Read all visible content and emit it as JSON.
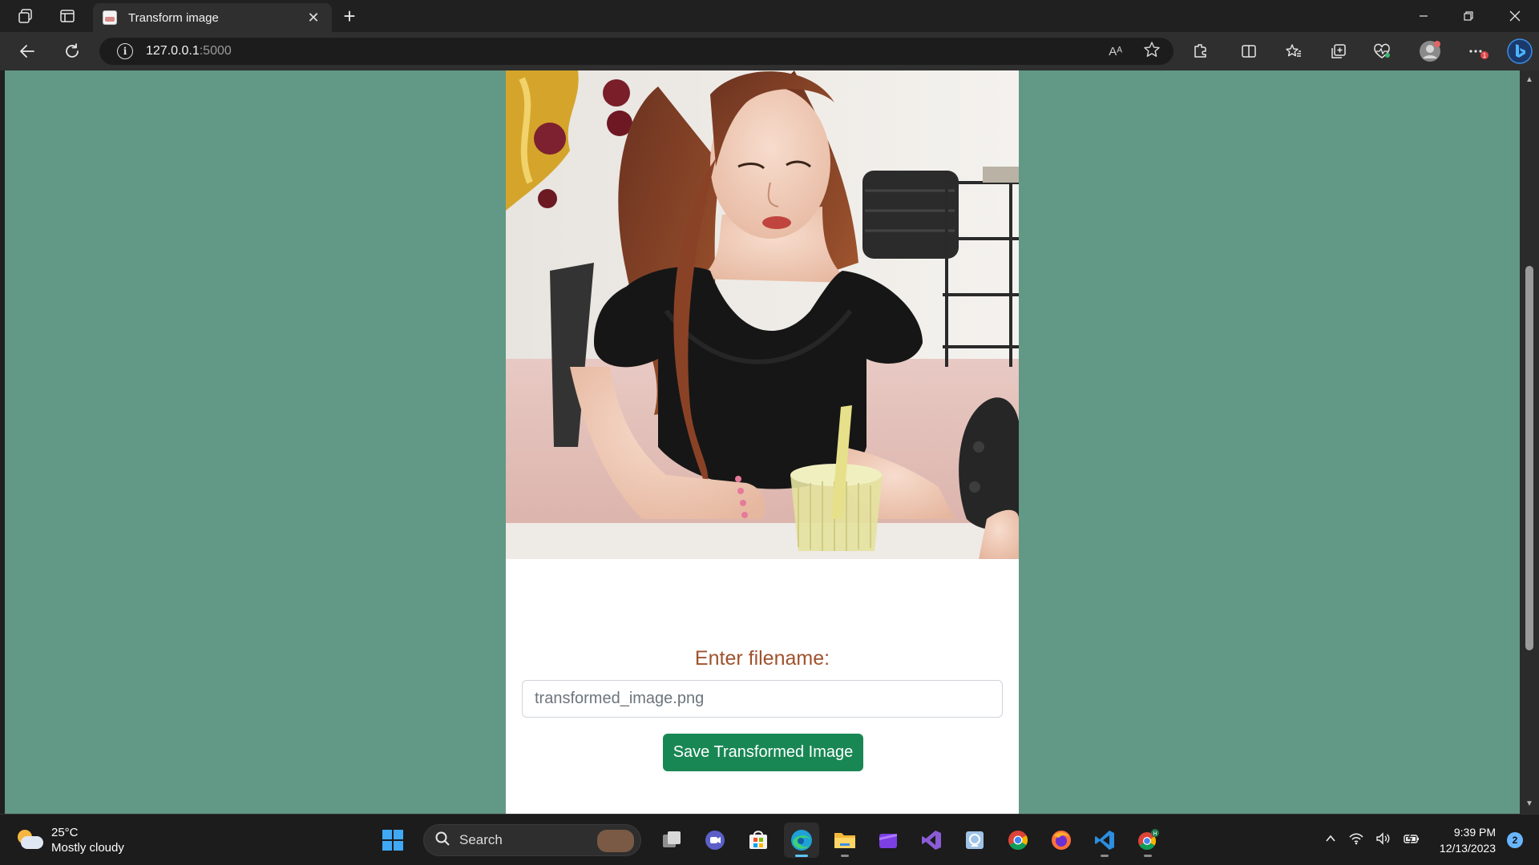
{
  "browser": {
    "tab_title": "Transform image",
    "tab_close": "✕",
    "new_tab": "+",
    "url_host": "127.0.0.1",
    "url_port": ":5000",
    "read_aloud_label": "Aᴬ"
  },
  "page": {
    "form_label": "Enter filename:",
    "filename_placeholder": "transformed_image.png",
    "filename_value": "",
    "save_button_label": "Save Transformed Image",
    "background_color": "#629886",
    "label_color": "#a0522d",
    "button_color": "#198754"
  },
  "taskbar": {
    "weather_temp": "25°C",
    "weather_desc": "Mostly cloudy",
    "search_label": "Search",
    "clock_time": "9:39 PM",
    "clock_date": "12/13/2023",
    "notification_count": "2",
    "apps": [
      "windows-start",
      "task-view",
      "teams-chat",
      "microsoft-store",
      "edge",
      "file-explorer",
      "clipchamp",
      "visual-studio",
      "remote-desktop",
      "chrome",
      "firefox",
      "vscode",
      "chrome-profile"
    ]
  }
}
